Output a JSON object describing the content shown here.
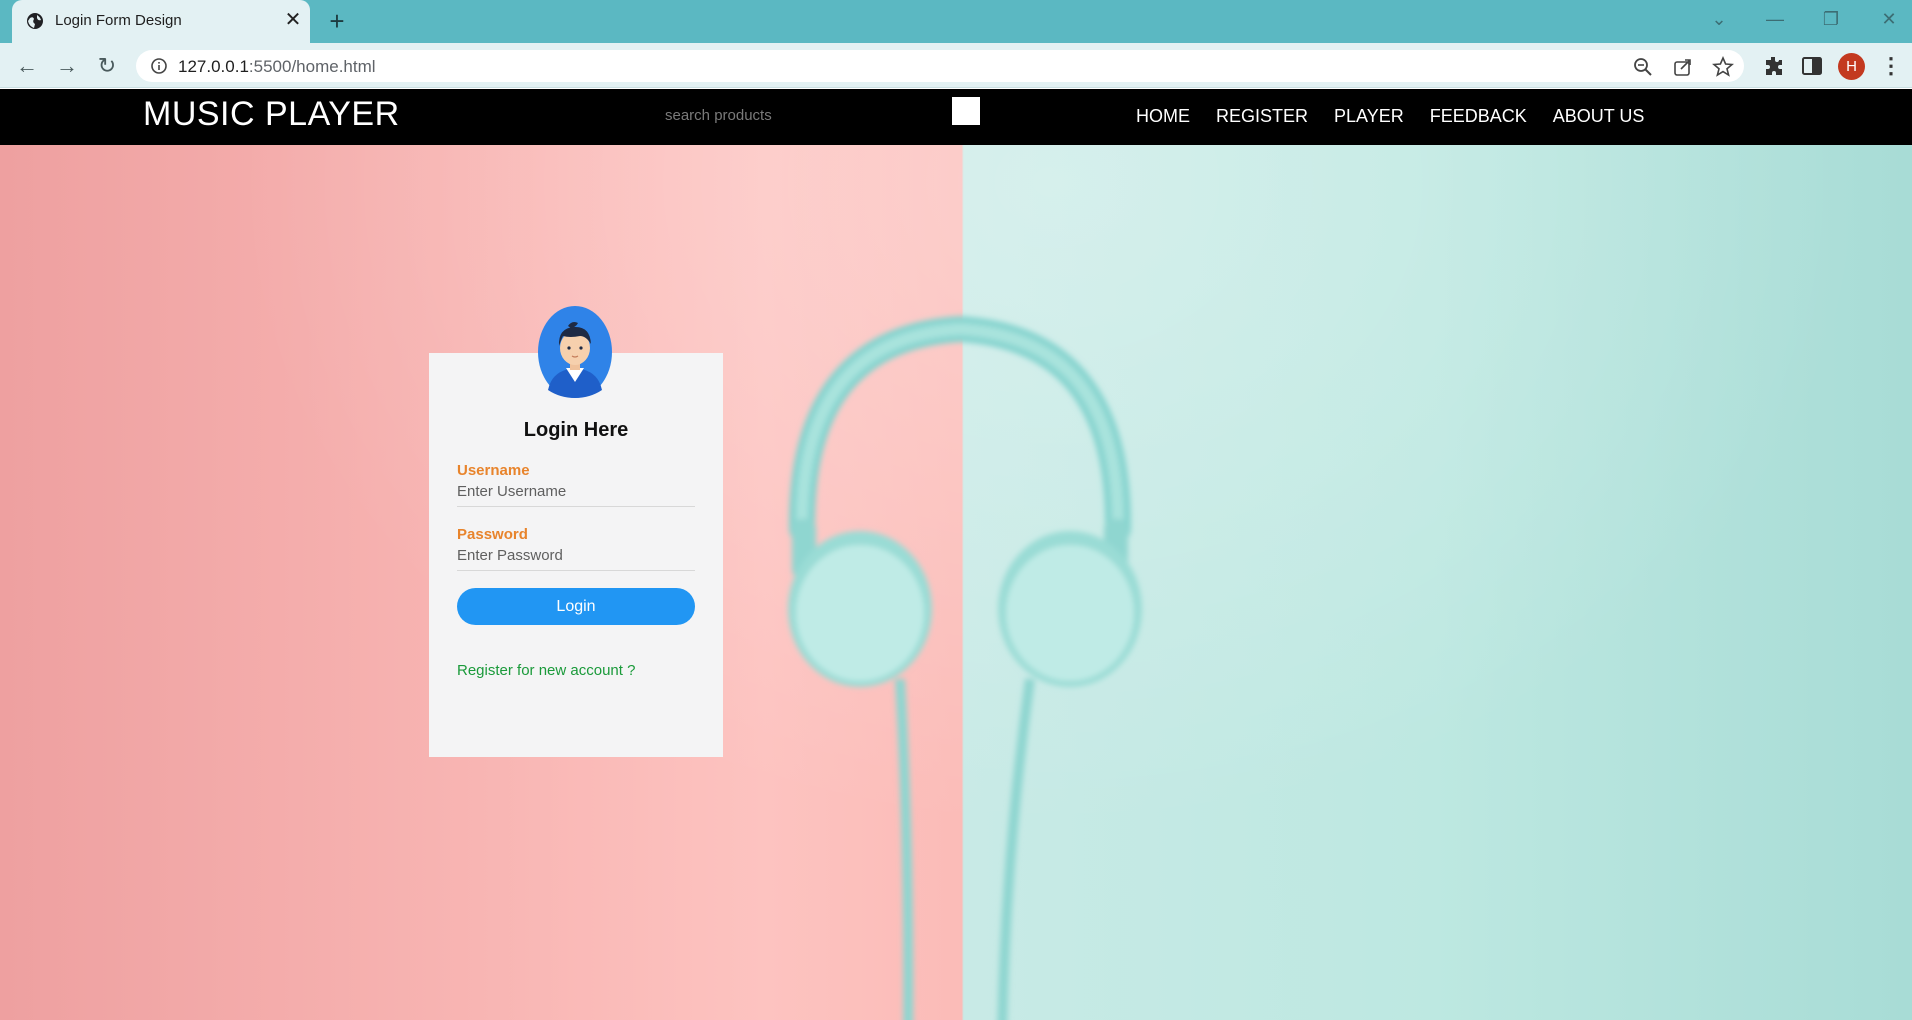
{
  "browser": {
    "tab_title": "Login Form Design",
    "tab_close": "✕",
    "new_tab": "+",
    "url_host": "127.0.0.1",
    "url_rest": ":5500/home.html",
    "profile_initial": "H",
    "window_controls": {
      "minimize": "—",
      "restore": "❐",
      "close": "✕",
      "tab_search": "⌄"
    },
    "nav": {
      "back": "←",
      "forward": "→",
      "reload": "↻"
    }
  },
  "navbar": {
    "brand": "MUSIC PLAYER",
    "search_placeholder": "search products",
    "links": [
      "HOME",
      "REGISTER",
      "PLAYER",
      "FEEDBACK",
      "ABOUT US"
    ]
  },
  "login": {
    "title": "Login Here",
    "username_label": "Username",
    "username_placeholder": "Enter Username",
    "password_label": "Password",
    "password_placeholder": "Enter Password",
    "button_label": "Login",
    "register_link": "Register for new account ?"
  },
  "colors": {
    "titlebar": "#5bb8c2",
    "navbar": "#000000",
    "label_accent": "#e8842c",
    "button": "#2196f3",
    "link": "#1a9a3a",
    "profile": "#c3391f"
  }
}
